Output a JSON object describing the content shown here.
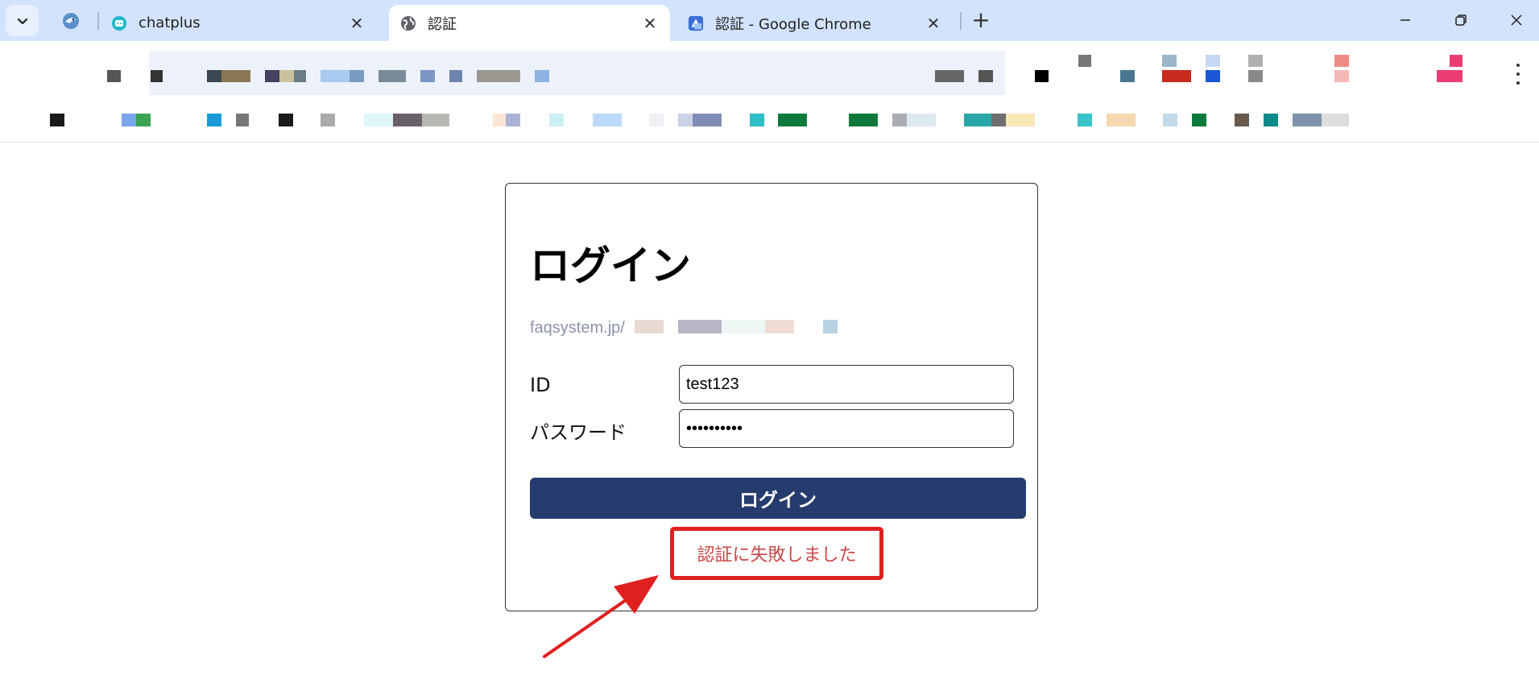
{
  "browser": {
    "tabs": [
      {
        "title": "chatplus",
        "active": false
      },
      {
        "title": "認証",
        "active": true
      },
      {
        "title": "認証 - Google Chrome",
        "active": false
      }
    ],
    "new_tab_label": "+",
    "close_symbol": "✕"
  },
  "login": {
    "heading": "ログイン",
    "url_text": "faqsystem.jp/",
    "id_label": "ID",
    "id_value": "test123",
    "password_label": "パスワード",
    "password_value": "••••••••••",
    "submit_label": "ログイン",
    "error_message": "認証に失敗しました"
  },
  "colors": {
    "tabstrip_bg": "#d3e3fd",
    "button_bg": "#263c6e",
    "error_text": "#cc4444",
    "annotation_red": "#e01f1f"
  }
}
